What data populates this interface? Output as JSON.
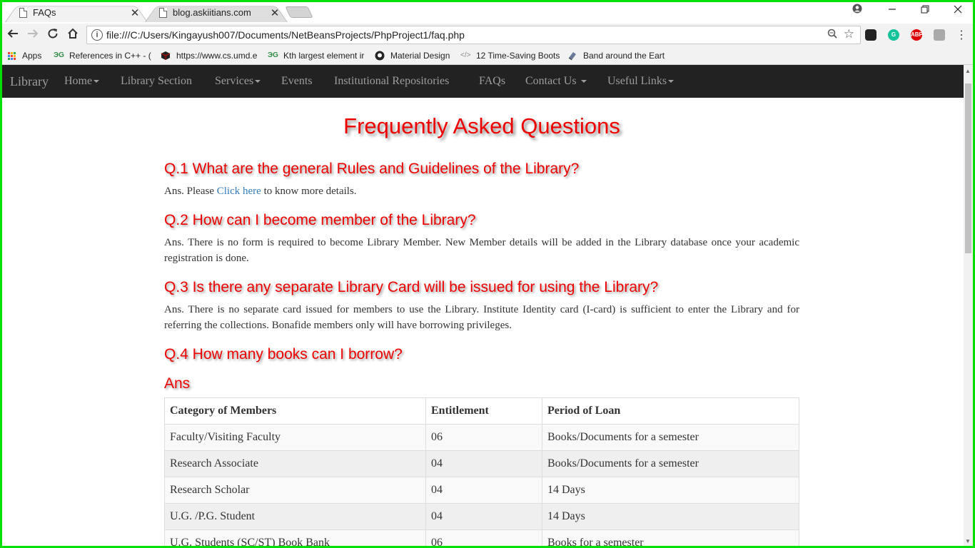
{
  "browser": {
    "tabs": [
      {
        "title": "FAQs",
        "active": true
      },
      {
        "title": "blog.askiitians.com",
        "active": false
      }
    ],
    "address": "file:///C:/Users/Kingayush007/Documents/NetBeansProjects/PhpProject1/faq.php",
    "bookmarks": [
      {
        "label": "Apps",
        "icon": "apps-grid-icon"
      },
      {
        "label": "References in C++ - (",
        "icon": "gfg-icon"
      },
      {
        "label": "https://www.cs.umd.e",
        "icon": "cube-icon"
      },
      {
        "label": "Kth largest element ir",
        "icon": "gfg-icon"
      },
      {
        "label": "Material Design",
        "icon": "github-icon"
      },
      {
        "label": "12 Time-Saving Boots",
        "icon": "code-icon"
      },
      {
        "label": "Band around the Eart",
        "icon": "book-icon"
      }
    ],
    "close_glyph": "✕",
    "extensions": {
      "abp": "ABP",
      "grammarly": "G"
    }
  },
  "site": {
    "brand": "Library",
    "nav": [
      {
        "label": "Home",
        "dropdown": true
      },
      {
        "label": "Library Section",
        "dropdown": false
      },
      {
        "label": "Services",
        "dropdown": true
      },
      {
        "label": "Events",
        "dropdown": false
      },
      {
        "label": "Institutional Repositories",
        "dropdown": false
      },
      {
        "label": "FAQs",
        "dropdown": false
      },
      {
        "label": "Contact Us ",
        "dropdown": true
      },
      {
        "label": "Useful Links",
        "dropdown": true
      }
    ]
  },
  "faq": {
    "title": "Frequently Asked Questions",
    "q1": {
      "question": "Q.1 What are the general Rules and Guidelines of the Library?",
      "answer_prefix": "Ans. Please ",
      "link": "Click here",
      "answer_suffix": " to know more details."
    },
    "q2": {
      "question": "Q.2 How can I become member of the Library?",
      "answer": "Ans. There is no form is required to become Library Member. New Member details will be added in the Library database once your academic registration is done."
    },
    "q3": {
      "question": "Q.3 Is there any separate Library Card will be issued for using the Library?",
      "answer": "Ans. There is no separate card issued for members to use the Library. Institute Identity card (I-card) is sufficient to enter the Library and for referring the collections. Bonafide members only will have borrowing privileges."
    },
    "q4": {
      "question": "Q.4 How many books can I borrow?",
      "ans_heading": "Ans"
    },
    "table": {
      "headers": [
        "Category of Members",
        "Entitlement",
        "Period of Loan"
      ],
      "rows": [
        [
          "Faculty/Visiting Faculty",
          "06",
          "Books/Documents for a semester"
        ],
        [
          "Research Associate",
          "04",
          "Books/Documents for a semester"
        ],
        [
          "Research Scholar",
          "04",
          "14 Days"
        ],
        [
          "U.G. /P.G. Student",
          "04",
          "14 Days"
        ],
        [
          "U.G. Students (SC/ST) Book Bank",
          "06",
          "Books for a semester"
        ]
      ]
    }
  },
  "colors": {
    "border": "#00e000",
    "heading": "#ee0000",
    "navbar": "#222222",
    "link": "#337ab7"
  }
}
